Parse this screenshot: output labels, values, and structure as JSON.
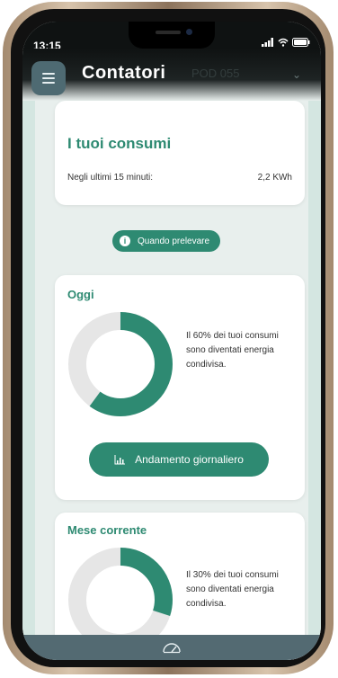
{
  "status_bar": {
    "time": "13:15",
    "signal_icon": "signal-icon",
    "wifi_icon": "wifi-icon",
    "battery_icon": "battery-icon"
  },
  "header": {
    "title": "Contatori",
    "pod_label": "POD 055",
    "menu_icon": "hamburger-menu-icon",
    "chevron_icon": "chevron-down-icon"
  },
  "consumi": {
    "title": "I tuoi consumi",
    "label": "Negli ultimi 15 minuti:",
    "value": "2,2 KWh"
  },
  "quando_button": {
    "label": "Quando prelevare",
    "icon": "info-icon"
  },
  "oggi": {
    "title": "Oggi",
    "share_percent": 60,
    "description": "Il 60% dei tuoi consumi sono diventati energia condivisa.",
    "button_label": "Andamento giornaliero",
    "button_icon": "bar-chart-icon"
  },
  "mese": {
    "title": "Mese corrente",
    "share_percent": 30,
    "description": "Il 30% dei tuoi consumi sono diventati energia condivisa."
  },
  "bottom_bar": {
    "icon": "gauge-icon"
  },
  "colors": {
    "accent": "#2e8a72",
    "donut_track": "#e6e6e6",
    "bottom_bar": "#536a72"
  }
}
